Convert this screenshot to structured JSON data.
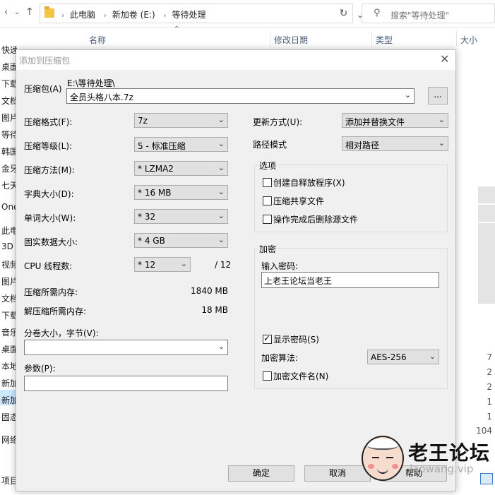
{
  "explorer": {
    "breadcrumb": [
      "此电脑",
      "新加卷 (E:)",
      "等待处理"
    ],
    "search_placeholder": "搜索\"等待处理\"",
    "columns": {
      "name": "名称",
      "date": "修改日期",
      "type": "类型",
      "size": "大小"
    },
    "sidebar": [
      "快速访问",
      "桌面",
      "下载",
      "文档",
      "图片",
      "等待",
      "韩国",
      "金牙",
      "七天",
      "OneD",
      "此电脑",
      "3D",
      "视频",
      "图片",
      "文档",
      "下载",
      "音乐",
      "桌面",
      "本地",
      "新加",
      "新加",
      "固态",
      "网络"
    ],
    "right_sizes": [
      "7",
      "2",
      "2",
      "1",
      "1",
      "104"
    ],
    "status_left": "项目"
  },
  "dialog": {
    "title": "添加到压缩包",
    "archive_label": "压缩包(A)",
    "archive_path": "E:\\等待处理\\",
    "archive_name": "全员头格八本.7z",
    "browse_label": "...",
    "format_label": "压缩格式(F):",
    "format_value": "7z",
    "level_label": "压缩等级(L):",
    "level_value": "5 - 标准压缩",
    "method_label": "压缩方法(M):",
    "method_value": "*  LZMA2",
    "dict_label": "字典大小(D):",
    "dict_value": "*  16 MB",
    "word_label": "单词大小(W):",
    "word_value": "*  32",
    "solid_label": "固实数据大小:",
    "solid_value": "*  4 GB",
    "cpu_label": "CPU 线程数:",
    "cpu_value": "*  12",
    "cpu_total": "/ 12",
    "mem_comp_label": "压缩所需内存:",
    "mem_comp_value": "1840 MB",
    "mem_decomp_label": "解压缩所需内存:",
    "mem_decomp_value": "18 MB",
    "split_label": "分卷大小，字节(V):",
    "split_value": "",
    "params_label": "参数(P):",
    "params_value": "",
    "update_label": "更新方式(U):",
    "update_value": "添加并替换文件",
    "path_label": "路径模式",
    "path_value": "相对路径",
    "options_title": "选项",
    "options": [
      {
        "label": "创建自释放程序(X)",
        "checked": false
      },
      {
        "label": "压缩共享文件",
        "checked": false
      },
      {
        "label": "操作完成后删除源文件",
        "checked": false
      }
    ],
    "encrypt_title": "加密",
    "password_label": "输入密码:",
    "password_value": "上老王论坛当老王",
    "show_password_label": "显示密码(S)",
    "show_password_checked": true,
    "enc_method_label": "加密算法:",
    "enc_method_value": "AES-256",
    "encrypt_names_label": "加密文件名(N)",
    "encrypt_names_checked": false,
    "ok_label": "确定",
    "cancel_label": "取消",
    "help_label": "帮助"
  },
  "watermark": {
    "title": "老王论坛",
    "url": "laowang.vip"
  },
  "check_mark": "✓"
}
